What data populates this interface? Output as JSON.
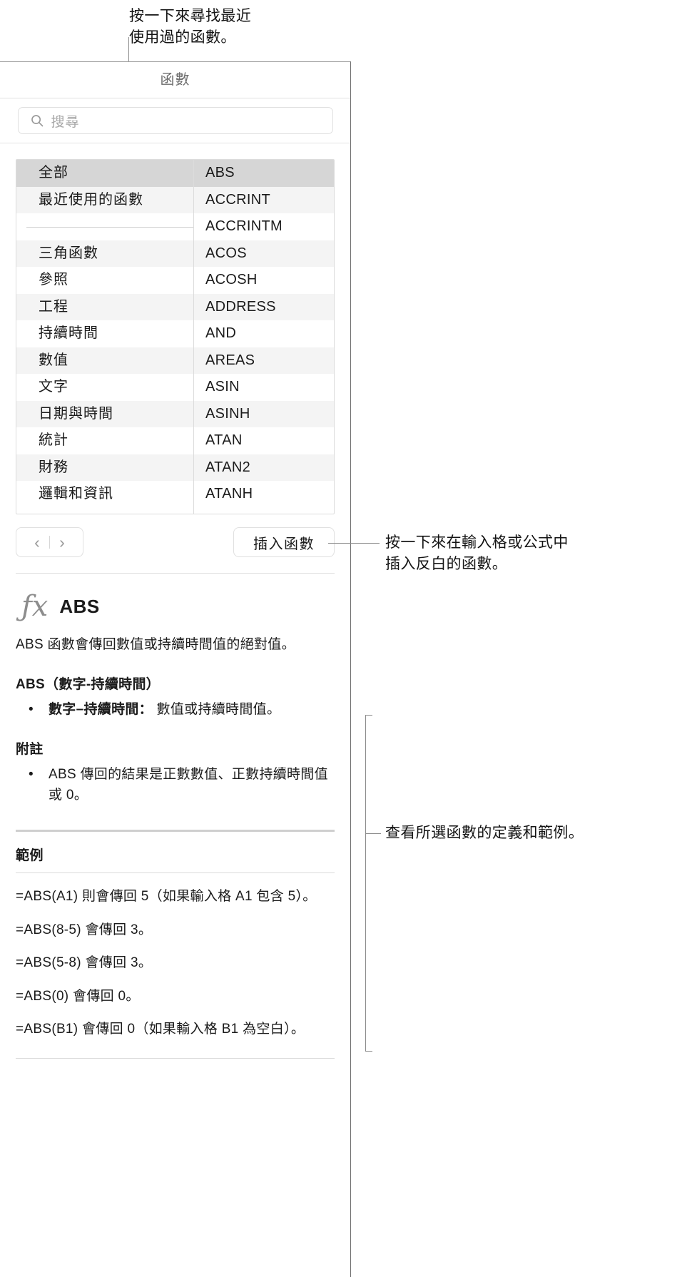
{
  "callouts": {
    "recent": "按一下來尋找最近\n使用過的函數。",
    "insert": "按一下來在輸入格或公式中\n插入反白的函數。",
    "detail": "查看所選函數的定義和範例。"
  },
  "panel": {
    "title": "函數",
    "search": {
      "placeholder": "搜尋",
      "value": "",
      "icon": "search-icon"
    },
    "categories": [
      {
        "label": "全部",
        "state": "selected"
      },
      {
        "label": "最近使用的函數",
        "state": "alt"
      },
      {
        "label": "",
        "state": "separator"
      },
      {
        "label": "三角函數",
        "state": "alt"
      },
      {
        "label": "參照",
        "state": "plain"
      },
      {
        "label": "工程",
        "state": "alt"
      },
      {
        "label": "持續時間",
        "state": "plain"
      },
      {
        "label": "數值",
        "state": "alt"
      },
      {
        "label": "文字",
        "state": "plain"
      },
      {
        "label": "日期與時間",
        "state": "alt"
      },
      {
        "label": "統計",
        "state": "plain"
      },
      {
        "label": "財務",
        "state": "alt"
      },
      {
        "label": "邏輯和資訊",
        "state": "plain"
      }
    ],
    "functions": [
      {
        "label": "ABS",
        "state": "selected"
      },
      {
        "label": "ACCRINT",
        "state": "alt"
      },
      {
        "label": "ACCRINTM",
        "state": "plain"
      },
      {
        "label": "ACOS",
        "state": "alt"
      },
      {
        "label": "ACOSH",
        "state": "plain"
      },
      {
        "label": "ADDRESS",
        "state": "alt"
      },
      {
        "label": "AND",
        "state": "plain"
      },
      {
        "label": "AREAS",
        "state": "alt"
      },
      {
        "label": "ASIN",
        "state": "plain"
      },
      {
        "label": "ASINH",
        "state": "alt"
      },
      {
        "label": "ATAN",
        "state": "plain"
      },
      {
        "label": "ATAN2",
        "state": "alt"
      },
      {
        "label": "ATANH",
        "state": "plain"
      }
    ],
    "toolbar": {
      "prev_icon": "chevron-left-icon",
      "prev_glyph": "‹",
      "next_icon": "chevron-right-icon",
      "next_glyph": "›",
      "insert_label": "插入函數"
    },
    "detail": {
      "fx_glyph": "ƒx",
      "name": "ABS",
      "description": "ABS 函數會傳回數值或持續時間值的絕對值。",
      "syntax_heading": "ABS（數字-持續時間）",
      "arguments": [
        {
          "term": "數字–持續時間：",
          "text": "數值或持續時間值。"
        }
      ],
      "notes_heading": "附註",
      "notes": [
        "ABS 傳回的結果是正數數值、正數持續時間值或 0。"
      ],
      "examples_heading": "範例",
      "examples": [
        "=ABS(A1) 則會傳回 5（如果輸入格 A1 包含 5）。",
        "=ABS(8-5) 會傳回 3。",
        "=ABS(5-8) 會傳回 3。",
        "=ABS(0) 會傳回 0。",
        "=ABS(B1) 會傳回 0（如果輸入格 B1 為空白）。"
      ]
    }
  }
}
